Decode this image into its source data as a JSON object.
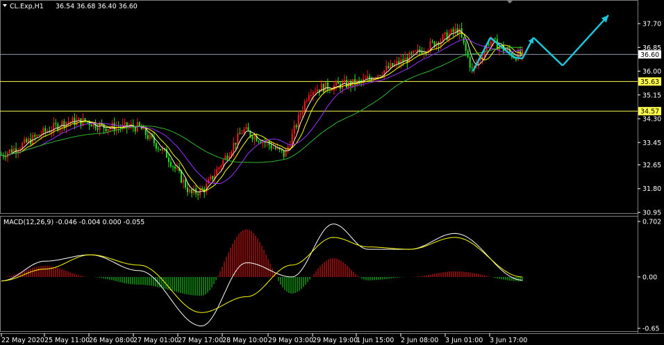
{
  "symbol_caption": "CL.Exp,H1",
  "ohlc": "36.54 36.68 36.40 36.60",
  "price_tag": "36.60",
  "hlines": [
    {
      "label": "35.63",
      "value": 35.63
    },
    {
      "label": "34.57",
      "value": 34.57
    }
  ],
  "price_axis": {
    "ticks": [
      "37.70",
      "36.85",
      "36.00",
      "35.15",
      "34.30",
      "33.45",
      "32.65",
      "31.80",
      "30.95"
    ],
    "range": [
      30.95,
      37.7
    ]
  },
  "macd": {
    "caption": "MACD(12,26,9) -0.046 -0.004 0.000 -0.055",
    "ticks": [
      "0.702",
      "0.00",
      "-0.65"
    ],
    "range": [
      -0.65,
      0.702
    ]
  },
  "time_axis": [
    "22 May 2020",
    "25 May 11:00",
    "26 May 08:00",
    "27 May 01:00",
    "27 May 17:00",
    "28 May 10:00",
    "29 May 03:00",
    "29 May 19:00",
    "1 Jun 15:00",
    "2 Jun 08:00",
    "3 Jun 01:00",
    "3 Jun 17:00"
  ],
  "colors": {
    "bull": "#ff1a1a",
    "bear": "#1ee81e",
    "hline": "#ffff4d",
    "price_line": "#8a9ab0",
    "arrow": "#19c8dc",
    "ma_fast": "#ffffcc",
    "ma_mid": "#ffff00",
    "ma_slow": "#9933ff",
    "ma_long": "#2fb82f",
    "macd_line": "#ffffff",
    "signal_line": "#ffff00"
  },
  "chart_data": {
    "type": "candlestick",
    "symbol": "CL.Exp",
    "timeframe": "H1",
    "current_price": 36.6,
    "last_bar": {
      "open": 36.54,
      "high": 36.68,
      "low": 36.4,
      "close": 36.6
    },
    "price_key_points": [
      {
        "x": "22 May 2020",
        "y": 33.0
      },
      {
        "x": "22 May",
        "y": 33.4
      },
      {
        "x": "25 May 11:00",
        "y": 33.8
      },
      {
        "x": "25 May",
        "y": 34.2
      },
      {
        "x": "26 May 08:00",
        "y": 34.2
      },
      {
        "x": "26 May",
        "y": 34.0
      },
      {
        "x": "27 May 01:00",
        "y": 34.0
      },
      {
        "x": "27 May",
        "y": 33.0
      },
      {
        "x": "27 May",
        "y": 31.6
      },
      {
        "x": "27 May 17:00",
        "y": 31.8
      },
      {
        "x": "28 May 10:00",
        "y": 33.9
      },
      {
        "x": "28 May",
        "y": 33.5
      },
      {
        "x": "29 May 03:00",
        "y": 33.0
      },
      {
        "x": "29 May",
        "y": 35.3
      },
      {
        "x": "29 May 19:00",
        "y": 35.4
      },
      {
        "x": "1 Jun 15:00",
        "y": 35.6
      },
      {
        "x": "2 Jun 08:00",
        "y": 36.5
      },
      {
        "x": "2 Jun",
        "y": 37.5
      },
      {
        "x": "3 Jun 01:00",
        "y": 36.0
      },
      {
        "x": "3 Jun",
        "y": 37.1
      },
      {
        "x": "3 Jun 17:00",
        "y": 36.55
      },
      {
        "x": "3 Jun",
        "y": 36.6
      }
    ],
    "macd_points": [
      {
        "x": "22 May 2020",
        "macd": -0.05,
        "signal": -0.05
      },
      {
        "x": "25 May 11:00",
        "macd": 0.2,
        "signal": 0.1
      },
      {
        "x": "26 May 08:00",
        "macd": 0.28,
        "signal": 0.28
      },
      {
        "x": "27 May 01:00",
        "macd": 0.08,
        "signal": 0.15
      },
      {
        "x": "27 May 17:00",
        "macd": -0.62,
        "signal": -0.45
      },
      {
        "x": "28 May 10:00",
        "macd": 0.18,
        "signal": -0.25
      },
      {
        "x": "29 May 03:00",
        "macd": 0.0,
        "signal": 0.15
      },
      {
        "x": "29 May 19:00",
        "macd": 0.67,
        "signal": 0.5
      },
      {
        "x": "1 Jun 15:00",
        "macd": 0.35,
        "signal": 0.38
      },
      {
        "x": "2 Jun 08:00",
        "macd": 0.35,
        "signal": 0.35
      },
      {
        "x": "3 Jun 01:00",
        "macd": 0.55,
        "signal": 0.5
      },
      {
        "x": "3 Jun 17:00",
        "macd": -0.04,
        "signal": 0.0
      }
    ],
    "forecast_path": [
      {
        "x": "3 Jun 01:00",
        "y": 36.0
      },
      {
        "x": "3 Jun",
        "y": 37.2
      },
      {
        "x": "3 Jun",
        "y": 36.5
      },
      {
        "x": "3 Jun 17:00",
        "y": 36.45
      },
      {
        "x": "4 Jun",
        "y": 37.2
      },
      {
        "x": "4 Jun",
        "y": 36.2
      },
      {
        "x": "5 Jun",
        "y": 38.0
      }
    ],
    "ylim": [
      30.95,
      37.7
    ],
    "macd_ylim": [
      -0.65,
      0.702
    ]
  }
}
